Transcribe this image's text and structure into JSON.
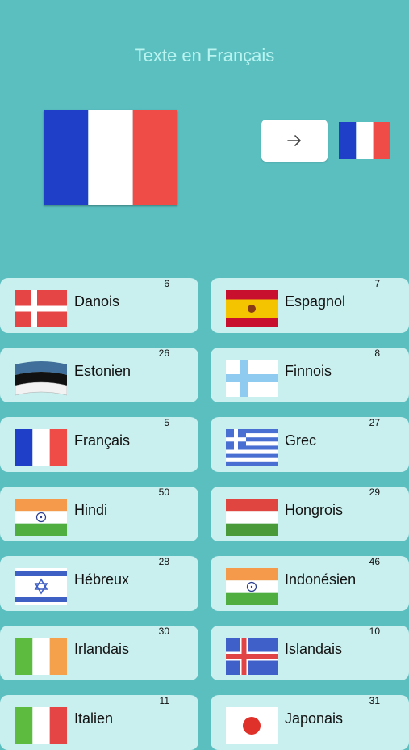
{
  "header": {
    "title": "Texte en Français"
  },
  "current_language": {
    "flag": "france-flag",
    "target_flag": "france-flag"
  },
  "colors": {
    "background": "#5bbfc0",
    "card": "#c9efee",
    "title": "#b9f4f1"
  },
  "languages": [
    {
      "name": "Danois",
      "count": "6",
      "flag": "denmark"
    },
    {
      "name": "Espagnol",
      "count": "7",
      "flag": "spain"
    },
    {
      "name": "Estonien",
      "count": "26",
      "flag": "estonia"
    },
    {
      "name": "Finnois",
      "count": "8",
      "flag": "finland"
    },
    {
      "name": "Français",
      "count": "5",
      "flag": "france"
    },
    {
      "name": "Grec",
      "count": "27",
      "flag": "greece"
    },
    {
      "name": "Hindi",
      "count": "50",
      "flag": "india"
    },
    {
      "name": "Hongrois",
      "count": "29",
      "flag": "hungary"
    },
    {
      "name": "Hébreux",
      "count": "28",
      "flag": "israel"
    },
    {
      "name": "Indonésien",
      "count": "46",
      "flag": "india"
    },
    {
      "name": "Irlandais",
      "count": "30",
      "flag": "ireland"
    },
    {
      "name": "Islandais",
      "count": "10",
      "flag": "iceland"
    },
    {
      "name": "Italien",
      "count": "11",
      "flag": "italy"
    },
    {
      "name": "Japonais",
      "count": "31",
      "flag": "japan"
    }
  ]
}
